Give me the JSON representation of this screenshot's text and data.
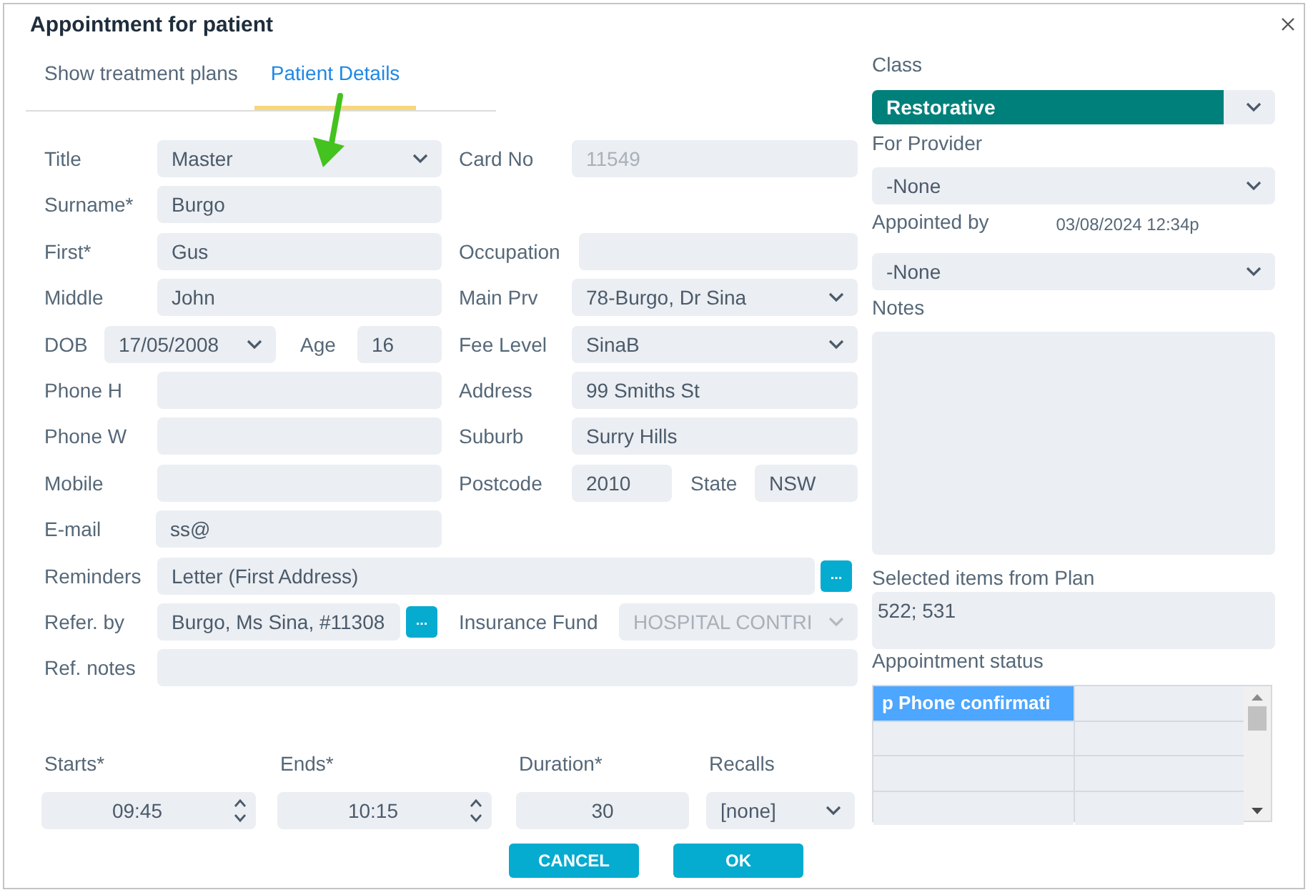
{
  "window": {
    "title": "Appointment for patient"
  },
  "tabs": [
    {
      "label": "Show treatment plans",
      "selected": false
    },
    {
      "label": "Patient Details",
      "selected": true
    }
  ],
  "patient": {
    "title": {
      "label": "Title",
      "value": "Master",
      "kind": "select",
      "disabled": false
    },
    "card_no": {
      "label": "Card No",
      "value": "11549",
      "disabled": true
    },
    "surname": {
      "label": "Surname*",
      "value": "Burgo",
      "disabled": false
    },
    "first": {
      "label": "First*",
      "value": "Gus",
      "disabled": false
    },
    "occupation": {
      "label": "Occupation"
    },
    "middle": {
      "label": "Middle",
      "value": "John",
      "disabled": false
    },
    "main_prv": {
      "label": "Main Prv",
      "value": "78-Burgo, Dr Sina",
      "kind": "select",
      "disabled": false
    },
    "dob": {
      "label": "DOB",
      "value": "17/05/2008",
      "kind": "select",
      "disabled": false
    },
    "age": {
      "label": "Age",
      "value": "16",
      "disabled": false
    },
    "fee_level": {
      "label": "Fee Level",
      "value": "SinaB",
      "kind": "select",
      "disabled": false
    },
    "phone_h": {
      "label": "Phone H"
    },
    "address": {
      "label": "Address",
      "value": "99 Smiths St",
      "disabled": false
    },
    "phone_w": {
      "label": "Phone W"
    },
    "suburb": {
      "label": "Suburb",
      "value": "Surry Hills",
      "disabled": false
    },
    "mobile": {
      "label": "Mobile"
    },
    "postcode": {
      "label": "Postcode",
      "value": "2010",
      "disabled": false
    },
    "state": {
      "label": "State",
      "value": "NSW",
      "disabled": false
    },
    "email": {
      "label": "E-mail",
      "value": "ss@",
      "disabled": false
    },
    "reminders": {
      "label": "Reminders",
      "value": "Letter (First Address)",
      "disabled": false,
      "button": "..."
    },
    "refer_by": {
      "label": "Refer. by",
      "value": "Burgo, Ms Sina, #11308",
      "disabled": false,
      "button": "..."
    },
    "insurance_fund": {
      "label": "Insurance Fund",
      "value": "HOSPITAL CONTRI",
      "kind": "select",
      "disabled": true
    },
    "ref_notes": {
      "label": "Ref. notes"
    }
  },
  "schedule": [
    {
      "label": "Starts*",
      "value": "09:45",
      "kind": "spin"
    },
    {
      "label": "Ends*",
      "value": "10:15",
      "kind": "spin"
    },
    {
      "label": "Duration*",
      "value": "30",
      "kind": "number"
    },
    {
      "label": "Recalls",
      "value": "[none]",
      "kind": "select"
    }
  ],
  "buttons": [
    "CANCEL",
    "OK"
  ],
  "right": {
    "class": {
      "label": "Class",
      "value": "Restorative",
      "color": "#00807a"
    },
    "for_provider": {
      "label": "For Provider",
      "value": "-None"
    },
    "appointed_by": {
      "label": "Appointed by",
      "timestamp": "03/08/2024 12:34p",
      "value": "-None"
    },
    "notes": {
      "label": "Notes"
    },
    "selected_items": {
      "label": "Selected items from Plan",
      "value": "522; 531"
    },
    "appointment_status": {
      "label": "Appointment status",
      "rows": [
        {
          "column_1": "p Phone confirmati",
          "selected": true
        },
        {
          "selected": false
        },
        {
          "selected": false
        },
        {
          "selected": false
        }
      ]
    }
  }
}
